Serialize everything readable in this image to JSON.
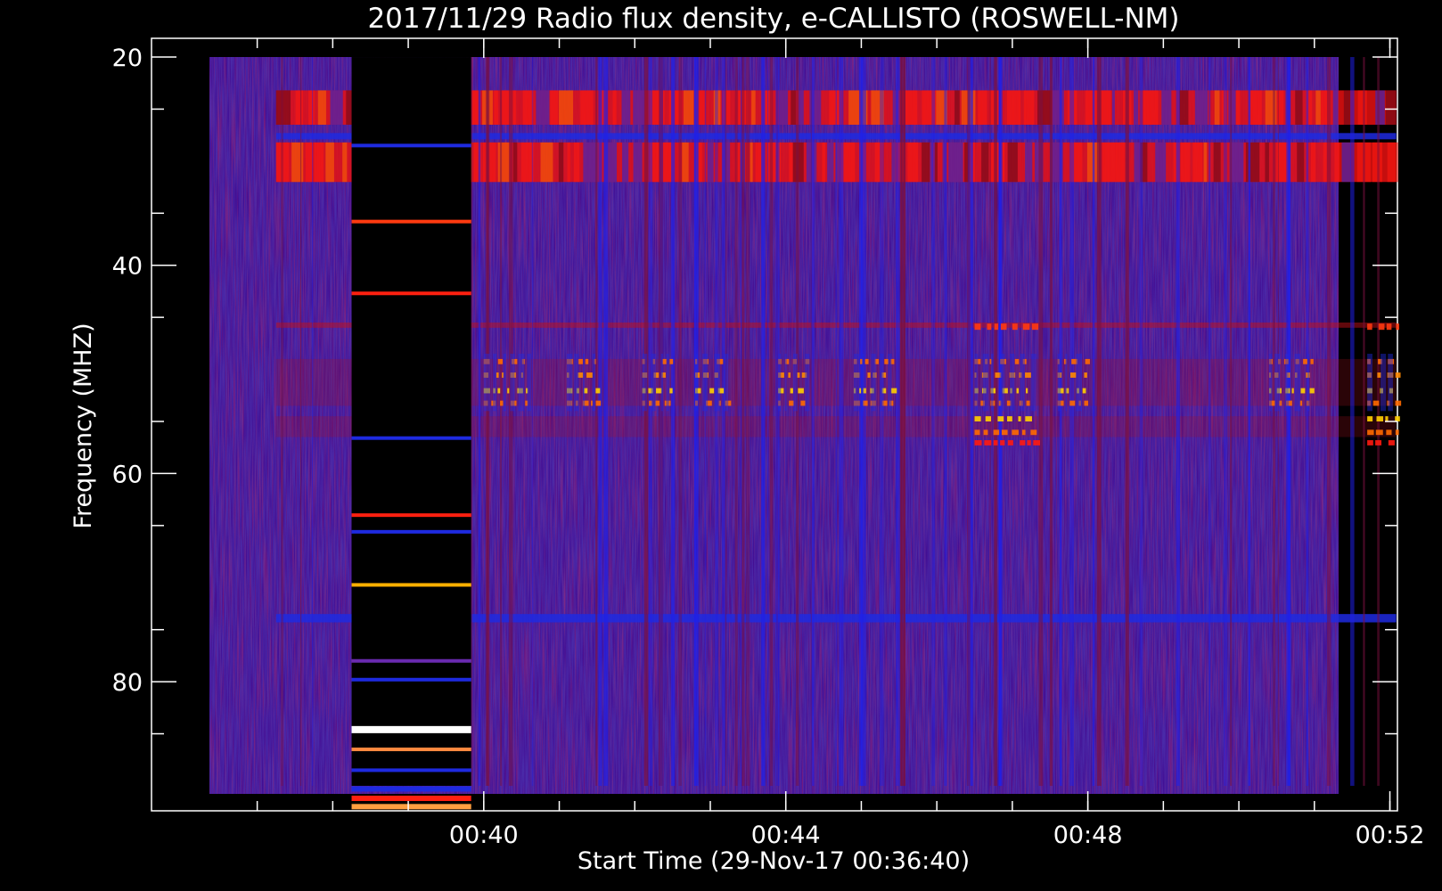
{
  "chart_data": {
    "type": "heatmap",
    "title": "2017/11/29  Radio flux density, e-CALLISTO (ROSWELL-NM)",
    "xlabel": "Start Time (29-Nov-17 00:36:40)",
    "ylabel": "Frequency (MHZ)",
    "x_range_minutes": [
      -4.4,
      12.1
    ],
    "x_ticks": [
      {
        "label": "00:40",
        "minute": 3.33
      },
      {
        "label": "00:44",
        "minute": 7.33
      },
      {
        "label": "00:48",
        "minute": 11.33
      },
      {
        "label": "00:52",
        "minute": 15.33
      }
    ],
    "y_range": [
      18.2,
      92.4
    ],
    "y_ticks": [
      20,
      40,
      60,
      80
    ],
    "y_inverted": true,
    "data_time_range": [
      "00:37:15",
      "00:52:05"
    ],
    "data_freq_range": [
      20,
      90
    ],
    "gap_time_range": [
      "00:38:15",
      "00:39:50"
    ],
    "colormap": [
      "#000000",
      "#1a1ab0",
      "#5a1ab4",
      "#8a1030",
      "#cc0000",
      "#ff6a00",
      "#ffd000",
      "#ffffff"
    ],
    "band_rows": [
      {
        "freq": [
          23.2,
          26.5
        ],
        "level": "high"
      },
      {
        "freq": [
          28.2,
          32.0
        ],
        "level": "high"
      },
      {
        "freq": [
          27.3,
          27.9
        ],
        "level": "blue"
      },
      {
        "freq": [
          45.5,
          46.0
        ],
        "level": "medium"
      },
      {
        "freq": [
          49.0,
          53.5
        ],
        "level": "burst"
      },
      {
        "freq": [
          54.5,
          56.5
        ],
        "level": "burst"
      },
      {
        "freq": [
          73.5,
          74.3
        ],
        "level": "blue"
      }
    ],
    "gap_lines_mhz": [
      28.5,
      35.8,
      42.7,
      56.6,
      64.0,
      65.6,
      70.7,
      78.0,
      79.8,
      84.6,
      86.5,
      88.5,
      90.3,
      91.2,
      92.0
    ]
  }
}
